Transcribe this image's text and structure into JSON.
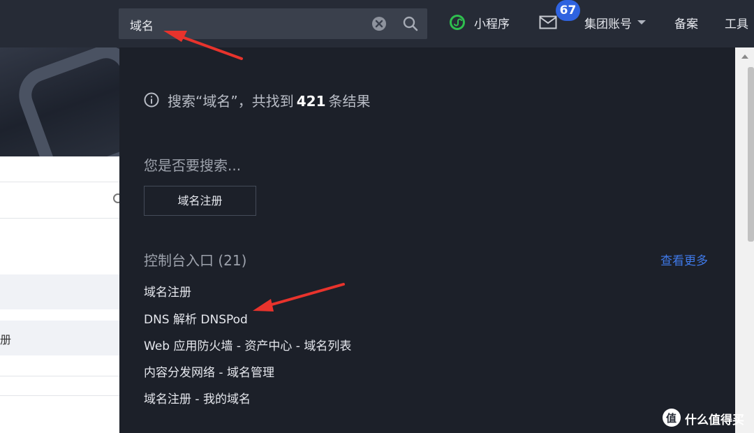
{
  "topbar": {
    "search_value": "域名",
    "mini_program": "小程序",
    "mail_badge": "67",
    "group_account": "集团账号",
    "filing": "备案",
    "tools": "工具"
  },
  "left_page": {
    "row_text": "册"
  },
  "dropdown": {
    "result_prefix": "搜索“域名”，共找到",
    "result_count": "421",
    "result_suffix": "条结果",
    "suggest_title": "您是否要搜索...",
    "suggest_button": "域名注册",
    "section_title": "控制台入口 (21)",
    "more_link": "查看更多",
    "entries": [
      "域名注册",
      "DNS 解析 DNSPod",
      "Web 应用防火墙 - 资产中心 - 域名列表",
      "内容分发网络 - 域名管理",
      "域名注册 - 我的域名"
    ]
  },
  "watermark": {
    "logo_text": "值",
    "text": "什么值得买"
  },
  "colors": {
    "topbar_bg": "#262b36",
    "panel_bg": "#1c2029",
    "link_blue": "#3f79e8",
    "badge_blue": "#2f63e0",
    "arrow_red": "#e8332c",
    "mini_green": "#2fbf4f"
  },
  "icons": [
    "clear-icon",
    "search-icon",
    "mini-program-icon",
    "mail-icon",
    "caret-down-icon",
    "info-icon",
    "arrow-annotation"
  ]
}
